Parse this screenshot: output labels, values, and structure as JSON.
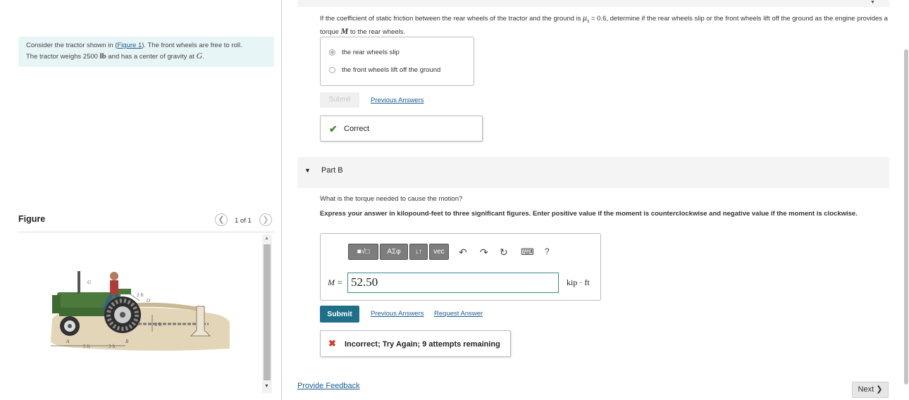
{
  "intro": {
    "line1_pre": "Consider the tractor shown in (",
    "figure_link": "Figure 1",
    "line1_post": "). The front wheels are free to roll.",
    "line2_pre": "The tractor weighs 2500 ",
    "weight_unit": "lb",
    "line2_mid": " and has a center of gravity at ",
    "cg_symbol": "G",
    "line2_post": "."
  },
  "figure": {
    "title": "Figure",
    "counter": "1 of 1",
    "labels": {
      "g": "G",
      "dim_2ft_top": "2 ft",
      "o": "O",
      "dim_2ft_side": "2 ft",
      "a": "A",
      "b": "B",
      "dim_5ft": "5 ft",
      "dim_3ft": "3 ft"
    }
  },
  "part_a": {
    "question_pre": "If the coefficient of static friction between the rear wheels of the tractor and the ground is ",
    "mu_symbol": "μ",
    "mu_sub": "s",
    "question_mid": " = 0.6, determine if the rear wheels slip or the front wheels lift off the ground as the engine provides a torque ",
    "torque_symbol": "M",
    "question_post": " to the rear wheels.",
    "choices": [
      "the rear wheels slip",
      "the front wheels lift off the ground"
    ],
    "submit_label": "Submit",
    "previous_answers": "Previous Answers",
    "feedback": "Correct"
  },
  "part_b": {
    "label": "Part B",
    "question": "What is the torque needed to cause the motion?",
    "instructions": "Express your answer in kilopound-feet to three significant figures. Enter positive value if the moment is counterclockwise and negative value if the moment is clockwise.",
    "toolbar": {
      "templates": "■√□",
      "greek": "ΑΣφ",
      "arrows": "↓↑",
      "vec": "vec",
      "undo": "↶",
      "redo": "↷",
      "reset": "↻",
      "keyboard": "⌨",
      "help": "?"
    },
    "answer_label": "M =",
    "answer_value": "52.50",
    "unit": "kip · ft",
    "submit_label": "Submit",
    "previous_answers": "Previous Answers",
    "request_answer": "Request Answer",
    "feedback": "Incorrect; Try Again; 9 attempts remaining"
  },
  "footer": {
    "provide_feedback": "Provide Feedback",
    "next": "Next ❯"
  }
}
